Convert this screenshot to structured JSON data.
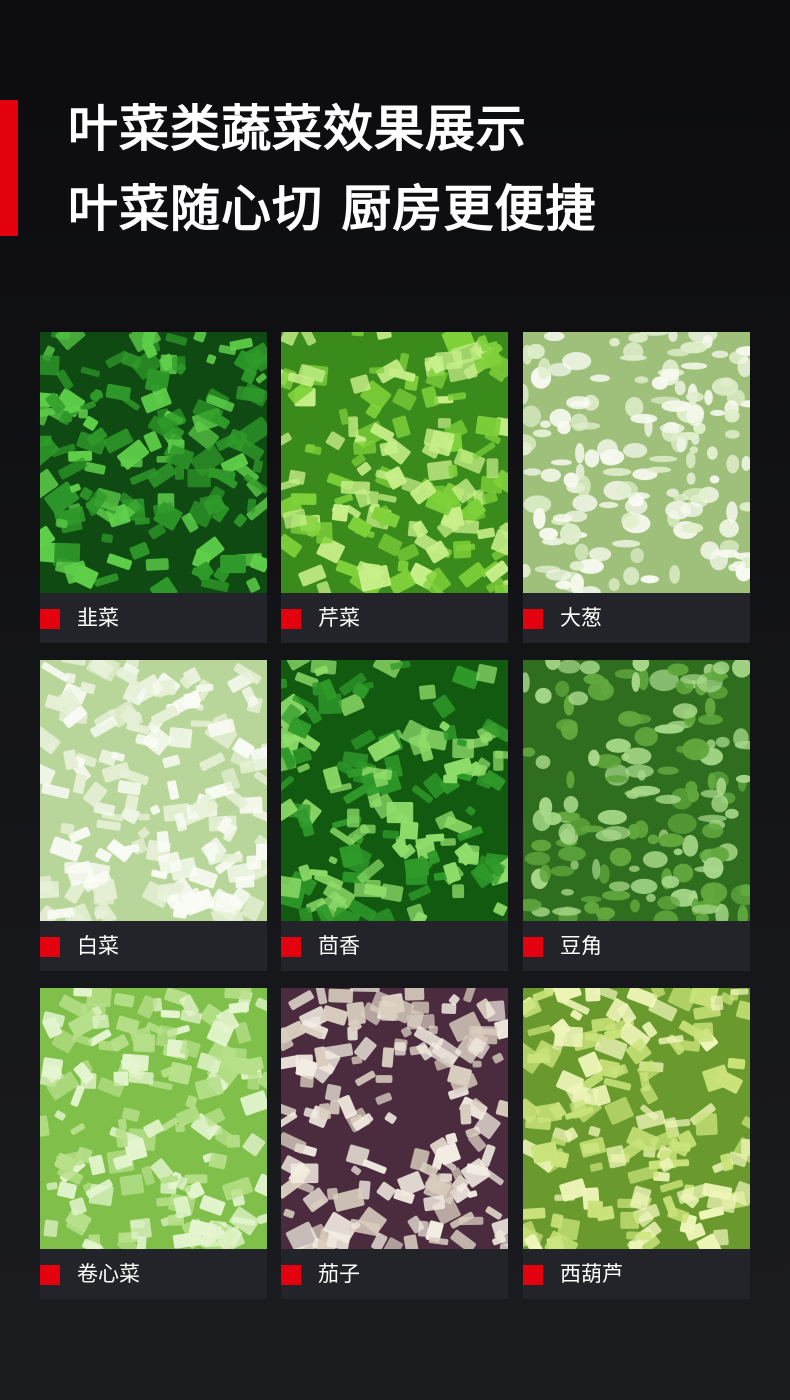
{
  "header": {
    "title_line1": "叶菜类蔬菜效果展示",
    "title_line2": "叶菜随心切 厨房更便捷"
  },
  "accent_color": "#e3000f",
  "vegetables": [
    {
      "label": "韭菜",
      "photo": "chopped-chives-photo",
      "colors": [
        "#0f4a12",
        "#2f9a2a",
        "#5fcf4a"
      ]
    },
    {
      "label": "芹菜",
      "photo": "diced-celery-photo",
      "colors": [
        "#3a8a1c",
        "#7fd13a",
        "#c8ef8a"
      ]
    },
    {
      "label": "大葱",
      "photo": "sliced-scallion-photo",
      "colors": [
        "#9fc07a",
        "#dfeecb",
        "#f7faf0"
      ]
    },
    {
      "label": "白菜",
      "photo": "chopped-cabbage-white-photo",
      "colors": [
        "#b9d69a",
        "#e6f0d6",
        "#fafcf6"
      ]
    },
    {
      "label": "茴香",
      "photo": "chopped-fennel-photo",
      "colors": [
        "#125a10",
        "#2f9a2a",
        "#8fdc6a"
      ]
    },
    {
      "label": "豆角",
      "photo": "cut-green-beans-photo",
      "colors": [
        "#2e6e1e",
        "#62a83e",
        "#a7d88a"
      ]
    },
    {
      "label": "卷心菜",
      "photo": "sliced-cabbage-photo",
      "colors": [
        "#7fbf4a",
        "#b7e08a",
        "#e4f5cf"
      ]
    },
    {
      "label": "茄子",
      "photo": "diced-eggplant-photo",
      "colors": [
        "#4a2c3e",
        "#d9cdbf",
        "#f3ece2"
      ]
    },
    {
      "label": "西葫芦",
      "photo": "diced-zucchini-photo",
      "colors": [
        "#6a9a2e",
        "#c9e37a",
        "#eef5b8"
      ]
    }
  ]
}
